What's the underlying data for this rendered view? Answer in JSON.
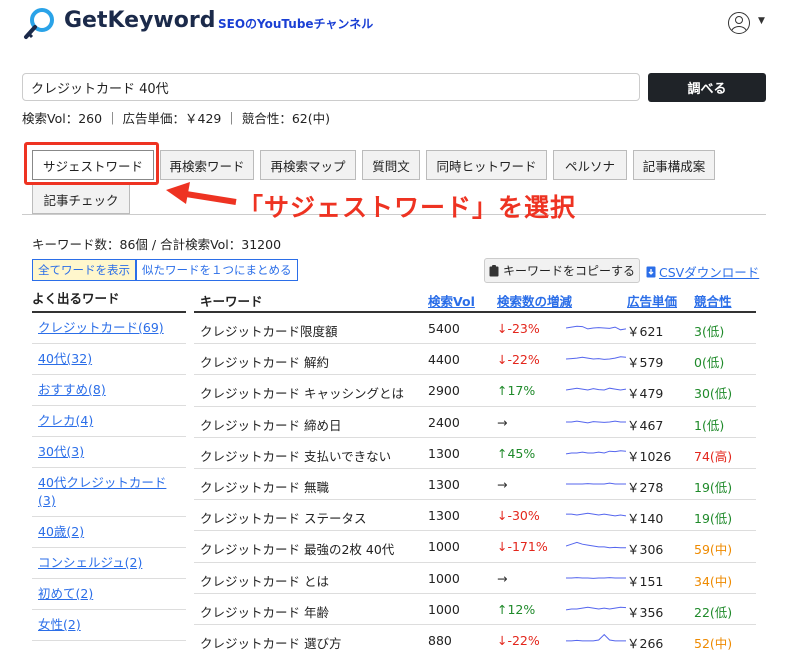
{
  "header": {
    "logo_text": "GetKeyword",
    "channel_link": "SEOのYouTubeチャンネル"
  },
  "search": {
    "value": "クレジットカード 40代",
    "button_label": "調べる"
  },
  "stats": "検索Vol：260 ｜ 広告単価：￥429 ｜ 競合性：62(中)",
  "tabs": [
    {
      "label": "サジェストワード",
      "active": true
    },
    {
      "label": "再検索ワード"
    },
    {
      "label": "再検索マップ"
    },
    {
      "label": "質問文"
    },
    {
      "label": "同時ヒットワード"
    },
    {
      "label": "ペルソナ"
    },
    {
      "label": "記事構成案"
    },
    {
      "label": "記事チェック"
    }
  ],
  "annotation": "「サジェストワード」を選択",
  "summary": "キーワード数：86個 / 合計検索Vol：31200",
  "toggles": [
    {
      "label": "全てワードを表示",
      "active": true
    },
    {
      "label": "似たワードを１つにまとめる"
    }
  ],
  "copy_button": "キーワードをコピーする",
  "csv_link": "CSVダウンロード",
  "left_column": {
    "header": "よく出るワード",
    "items": [
      "クレジットカード(69)",
      "40代(32)",
      "おすすめ(8)",
      "クレカ(4)",
      "30代(3)",
      "40代クレジットカード(3)",
      "40歳(2)",
      "コンシェルジュ(2)",
      "初めて(2)",
      "女性(2)"
    ]
  },
  "table": {
    "headers": {
      "keyword": "キーワード",
      "volume": "検索Vol",
      "trend": "検索数の増減",
      "cpc": "広告単価",
      "competition": "競合性"
    },
    "rows": [
      {
        "keyword": "クレジットカード限度額",
        "volume": "5400",
        "trend": "↓-23%",
        "trend_dir": "down",
        "spark": [
          0.5,
          0.55,
          0.6,
          0.58,
          0.45,
          0.5,
          0.52,
          0.5,
          0.48,
          0.55,
          0.4,
          0.45
        ],
        "cpc": "￥621",
        "competition": "3(低)",
        "comp_level": "low"
      },
      {
        "keyword": "クレジットカード 解約",
        "volume": "4400",
        "trend": "↓-22%",
        "trend_dir": "down",
        "spark": [
          0.5,
          0.52,
          0.55,
          0.6,
          0.55,
          0.5,
          0.52,
          0.48,
          0.5,
          0.55,
          0.62,
          0.6
        ],
        "cpc": "￥579",
        "competition": "0(低)",
        "comp_level": "low"
      },
      {
        "keyword": "クレジットカード キャッシングとは",
        "volume": "2900",
        "trend": "↑17%",
        "trend_dir": "up",
        "spark": [
          0.5,
          0.55,
          0.6,
          0.55,
          0.5,
          0.58,
          0.52,
          0.5,
          0.6,
          0.55,
          0.5,
          0.55
        ],
        "cpc": "￥479",
        "competition": "30(低)",
        "comp_level": "low"
      },
      {
        "keyword": "クレジットカード 締め日",
        "volume": "2400",
        "trend": "→",
        "trend_dir": "flat",
        "spark": [
          0.5,
          0.5,
          0.55,
          0.5,
          0.45,
          0.52,
          0.5,
          0.48,
          0.5,
          0.55,
          0.5,
          0.5
        ],
        "cpc": "￥467",
        "competition": "1(低)",
        "comp_level": "low"
      },
      {
        "keyword": "クレジットカード 支払いできない",
        "volume": "1300",
        "trend": "↑45%",
        "trend_dir": "up",
        "spark": [
          0.45,
          0.5,
          0.5,
          0.55,
          0.5,
          0.5,
          0.55,
          0.5,
          0.6,
          0.58,
          0.62,
          0.6
        ],
        "cpc": "￥1026",
        "competition": "74(高)",
        "comp_level": "high"
      },
      {
        "keyword": "クレジットカード 無職",
        "volume": "1300",
        "trend": "→",
        "trend_dir": "flat",
        "spark": [
          0.5,
          0.5,
          0.5,
          0.5,
          0.52,
          0.5,
          0.5,
          0.5,
          0.55,
          0.5,
          0.5,
          0.5
        ],
        "cpc": "￥278",
        "competition": "19(低)",
        "comp_level": "low"
      },
      {
        "keyword": "クレジットカード ステータス",
        "volume": "1300",
        "trend": "↓-30%",
        "trend_dir": "down",
        "spark": [
          0.55,
          0.55,
          0.5,
          0.55,
          0.6,
          0.55,
          0.5,
          0.55,
          0.5,
          0.45,
          0.5,
          0.45
        ],
        "cpc": "￥140",
        "competition": "19(低)",
        "comp_level": "low"
      },
      {
        "keyword": "クレジットカード 最強の2枚 40代",
        "volume": "1000",
        "trend": "↓-171%",
        "trend_dir": "down",
        "spark": [
          0.5,
          0.6,
          0.7,
          0.6,
          0.55,
          0.5,
          0.45,
          0.45,
          0.4,
          0.42,
          0.4,
          0.4
        ],
        "cpc": "￥306",
        "competition": "59(中)",
        "comp_level": "mid"
      },
      {
        "keyword": "クレジットカード とは",
        "volume": "1000",
        "trend": "→",
        "trend_dir": "flat",
        "spark": [
          0.5,
          0.5,
          0.52,
          0.5,
          0.5,
          0.48,
          0.5,
          0.5,
          0.52,
          0.5,
          0.5,
          0.5
        ],
        "cpc": "￥151",
        "competition": "34(中)",
        "comp_level": "mid"
      },
      {
        "keyword": "クレジットカード 年齢",
        "volume": "1000",
        "trend": "↑12%",
        "trend_dir": "up",
        "spark": [
          0.45,
          0.5,
          0.5,
          0.55,
          0.6,
          0.55,
          0.5,
          0.55,
          0.5,
          0.55,
          0.6,
          0.58
        ],
        "cpc": "￥356",
        "competition": "22(低)",
        "comp_level": "low"
      },
      {
        "keyword": "クレジットカード 選び方",
        "volume": "880",
        "trend": "↓-22%",
        "trend_dir": "down",
        "spark": [
          0.45,
          0.45,
          0.48,
          0.45,
          0.45,
          0.45,
          0.5,
          0.8,
          0.5,
          0.45,
          0.45,
          0.45
        ],
        "cpc": "￥266",
        "competition": "52(中)",
        "comp_level": "mid"
      }
    ]
  },
  "colors": {
    "brand_dark": "#1b2a4a",
    "link_blue": "#2b6ee8",
    "highlight_red": "#ee3322",
    "up_green": "#1f8a2a",
    "down_red": "#e3261c",
    "mid_orange": "#ee8a00",
    "spark_line": "#5566ee"
  }
}
